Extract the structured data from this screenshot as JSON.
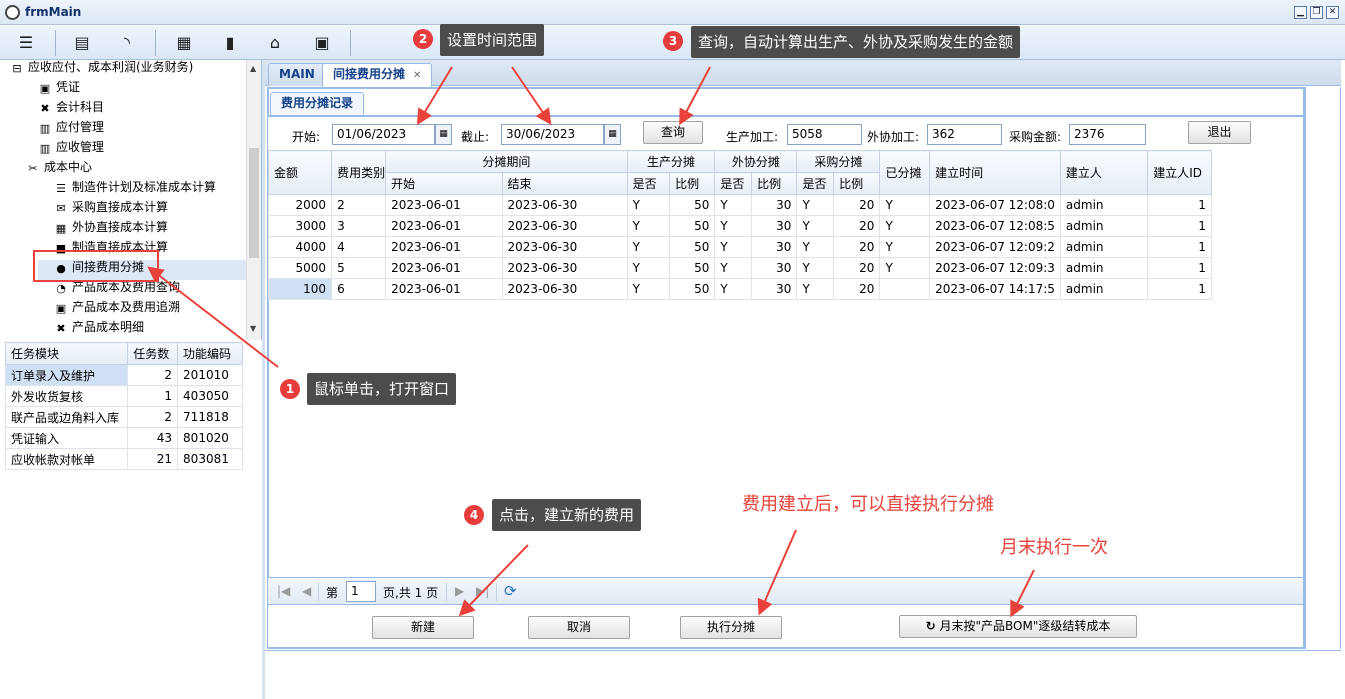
{
  "window": {
    "title": "frmMain"
  },
  "toolbar": {
    "icons": [
      "menu-icon",
      "calculator-icon",
      "rss-icon",
      "calendar-icon",
      "bookmark-icon",
      "inbox-icon",
      "image-icon"
    ]
  },
  "tree": {
    "items": [
      {
        "label": "应收应付、成本利润(业务财务)",
        "icon": "⊟",
        "indent": 0
      },
      {
        "label": "凭证",
        "icon": "▣",
        "indent": 2
      },
      {
        "label": "会计科目",
        "icon": "✖",
        "indent": 2
      },
      {
        "label": "应付管理",
        "icon": "▥",
        "indent": 2
      },
      {
        "label": "应收管理",
        "icon": "▥",
        "indent": 2
      },
      {
        "label": "成本中心",
        "icon": "✂",
        "indent": 1
      },
      {
        "label": "制造件计划及标准成本计算",
        "icon": "☰",
        "indent": 3
      },
      {
        "label": "采购直接成本计算",
        "icon": "✉",
        "indent": 3
      },
      {
        "label": "外协直接成本计算",
        "icon": "▦",
        "indent": 3
      },
      {
        "label": "制造直接成本计算",
        "icon": "■",
        "indent": 3
      },
      {
        "label": "间接费用分摊",
        "icon": "●",
        "indent": 3
      },
      {
        "label": "产品成本及费用查询",
        "icon": "◔",
        "indent": 3
      },
      {
        "label": "产品成本及费用追溯",
        "icon": "▣",
        "indent": 3
      },
      {
        "label": "产品成本明细",
        "icon": "✖",
        "indent": 3
      }
    ]
  },
  "tasks": {
    "headers": [
      "任务模块",
      "任务数",
      "功能编码"
    ],
    "rows": [
      [
        "订单录入及维护",
        "2",
        "201010"
      ],
      [
        "外发收货复核",
        "1",
        "403050"
      ],
      [
        "联产品或边角料入库",
        "2",
        "711818"
      ],
      [
        "凭证输入",
        "43",
        "801020"
      ],
      [
        "应收帐款对帐单",
        "21",
        "803081"
      ]
    ]
  },
  "tabs": {
    "main": "MAIN",
    "active": "间接费用分摊"
  },
  "subtab": "费用分摊记录",
  "filter": {
    "start_label": "开始:",
    "start_value": "01/06/2023",
    "end_label": "截止:",
    "end_value": "30/06/2023",
    "query": "查询",
    "prod_label": "生产加工:",
    "prod_value": "5058",
    "outs_label": "外协加工:",
    "outs_value": "362",
    "purch_label": "采购金额:",
    "purch_value": "2376",
    "exit": "退出"
  },
  "grid": {
    "h_amount": "金额",
    "h_type": "费用类别",
    "h_period": "分摊期间",
    "h_start": "开始",
    "h_end": "结束",
    "h_prod": "生产分摊",
    "h_outs": "外协分摊",
    "h_purch": "采购分摊",
    "h_yes": "是否",
    "h_ratio": "比例",
    "h_done": "已分摊",
    "h_created": "建立时间",
    "h_creator": "建立人",
    "h_creator_id": "建立人ID",
    "rows": [
      [
        "2000",
        "2",
        "2023-06-01",
        "2023-06-30",
        "Y",
        "50",
        "Y",
        "30",
        "Y",
        "20",
        "Y",
        "2023-06-07 12:08:0",
        "admin",
        "1"
      ],
      [
        "3000",
        "3",
        "2023-06-01",
        "2023-06-30",
        "Y",
        "50",
        "Y",
        "30",
        "Y",
        "20",
        "Y",
        "2023-06-07 12:08:5",
        "admin",
        "1"
      ],
      [
        "4000",
        "4",
        "2023-06-01",
        "2023-06-30",
        "Y",
        "50",
        "Y",
        "30",
        "Y",
        "20",
        "Y",
        "2023-06-07 12:09:2",
        "admin",
        "1"
      ],
      [
        "5000",
        "5",
        "2023-06-01",
        "2023-06-30",
        "Y",
        "50",
        "Y",
        "30",
        "Y",
        "20",
        "Y",
        "2023-06-07 12:09:3",
        "admin",
        "1"
      ],
      [
        "100",
        "6",
        "2023-06-01",
        "2023-06-30",
        "Y",
        "50",
        "Y",
        "30",
        "Y",
        "20",
        "",
        "2023-06-07 14:17:5",
        "admin",
        "1"
      ]
    ]
  },
  "pager": {
    "page_prefix": "第",
    "page_value": "1",
    "page_suffix": "页,共 1 页"
  },
  "buttons": {
    "new": "新建",
    "cancel": "取消",
    "execute": "执行分摊",
    "monthly": "月末按\"产品BOM\"逐级结转成本"
  },
  "annotations": {
    "c1": "鼠标单击，打开窗口",
    "n1": "1",
    "c2": "设置时间范围",
    "n2": "2",
    "c3": "查询，自动计算出生产、外协及采购发生的金额",
    "n3": "3",
    "c4": "点击，建立新的费用",
    "n4": "4",
    "red1": "费用建立后，可以直接执行分摊",
    "red2": "月末执行一次"
  },
  "colors": {
    "accent": "#15428b",
    "annotation_red": "#e8423a",
    "callout_bg": "#4c4c4c"
  }
}
